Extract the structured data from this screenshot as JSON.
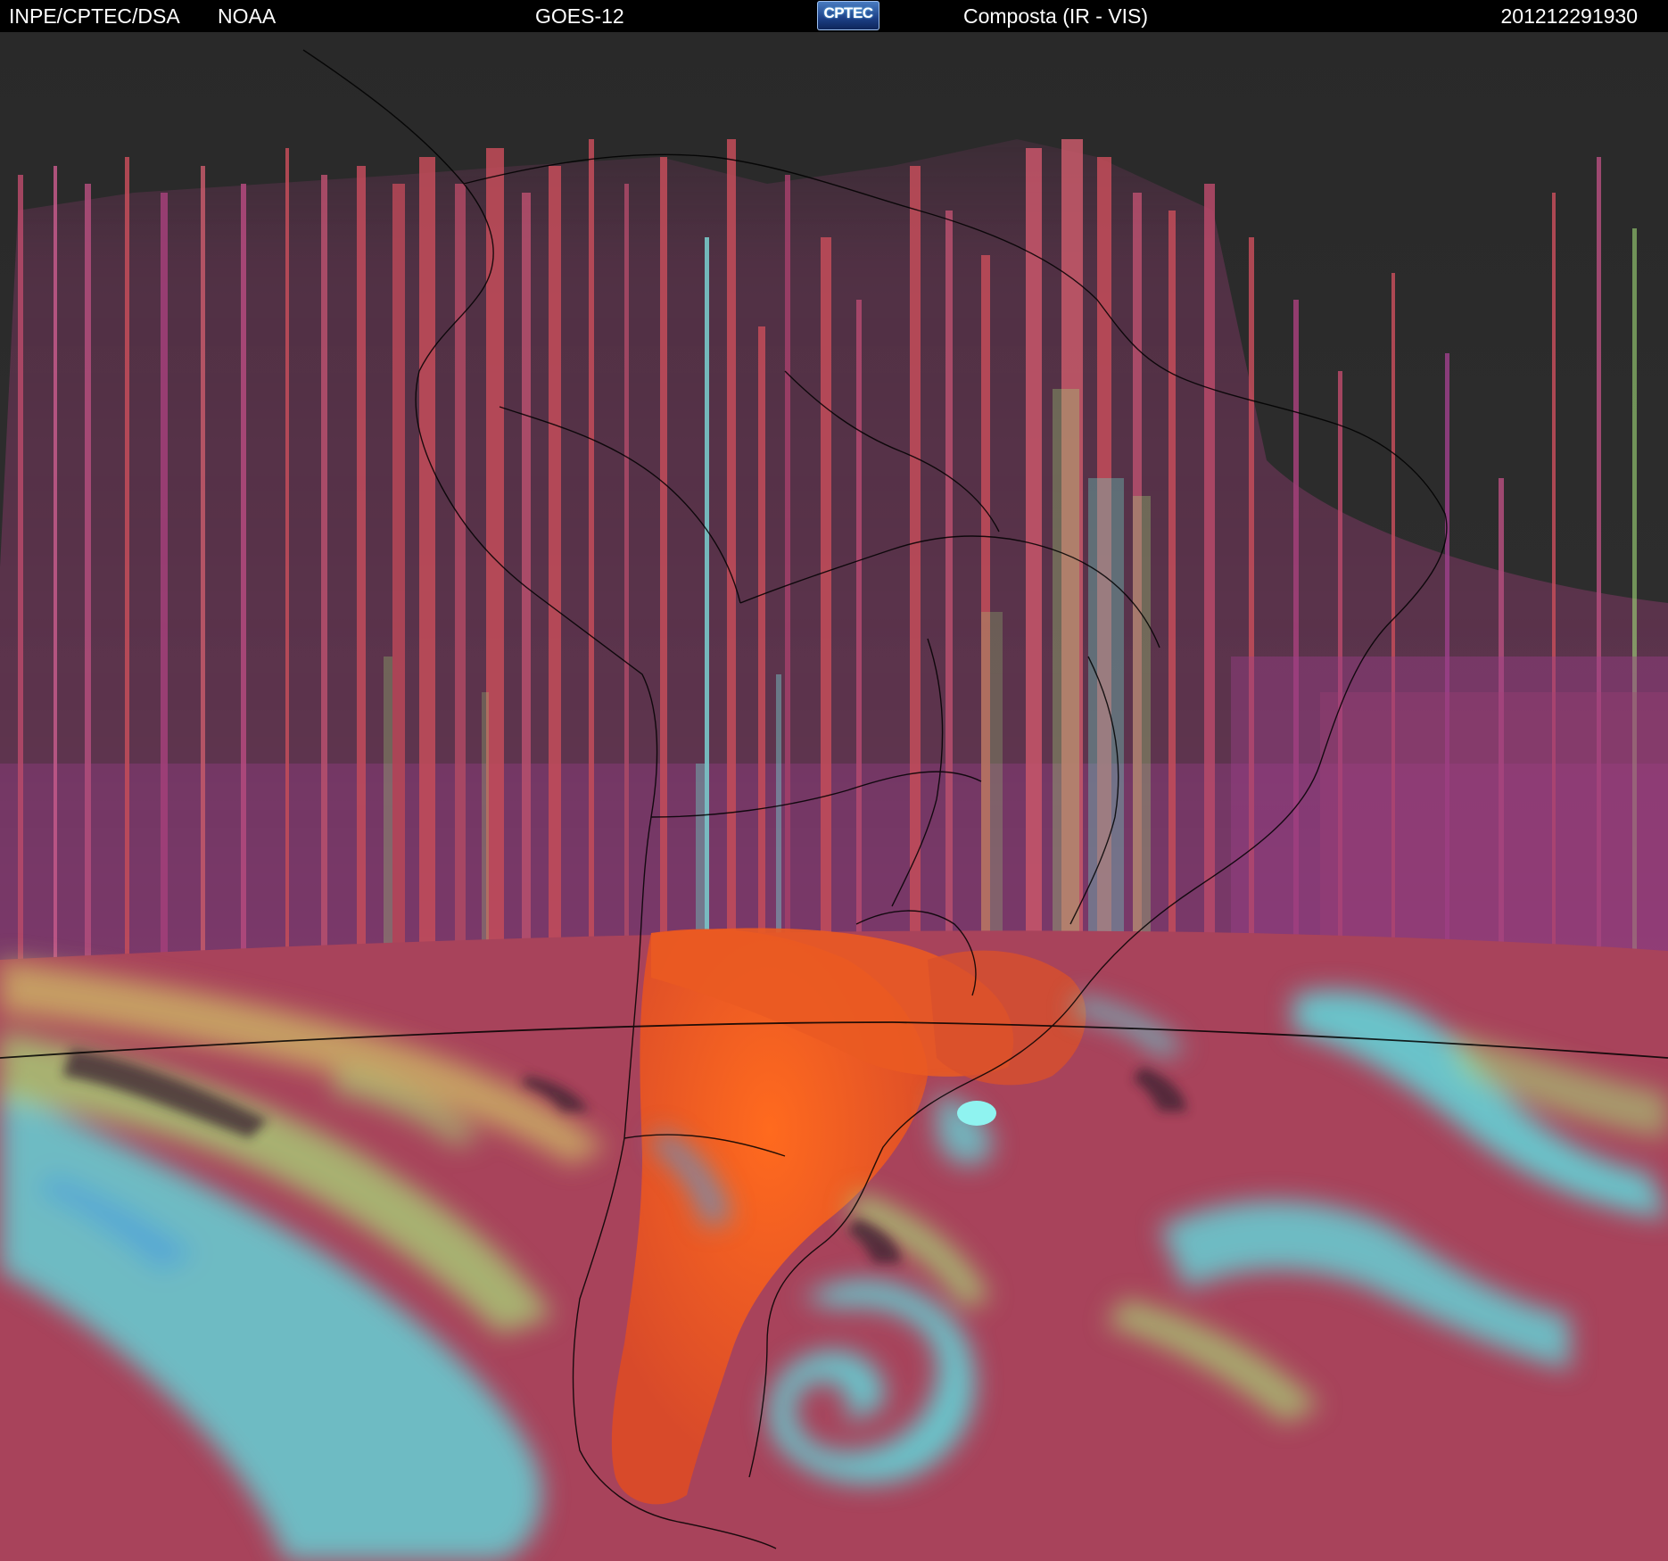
{
  "header": {
    "agency": "INPE/CPTEC/DSA",
    "source": "NOAA",
    "satellite": "GOES-12",
    "logo_text": "CPTEC",
    "product": "Composta (IR - VIS)",
    "timestamp": "201212291930"
  },
  "colors": {
    "header_background": "#000000",
    "header_text": "#ffffff",
    "space_background": "#2b2b2b",
    "ir_streak_red": "#c44d5a",
    "ir_streak_magenta": "#9a3f88",
    "ir_streak_green": "#9fd878",
    "ir_streak_cyan": "#6fd4c4",
    "daylight_ocean": "#a8435b",
    "land_orange": "#ea5a22",
    "cloud_cyan": "#5be3e6",
    "cloud_green": "#a8e07a",
    "cloud_yellow": "#d8d86a",
    "coastline": "#000000"
  },
  "icons": {
    "logo": "cptec-logo-icon"
  }
}
